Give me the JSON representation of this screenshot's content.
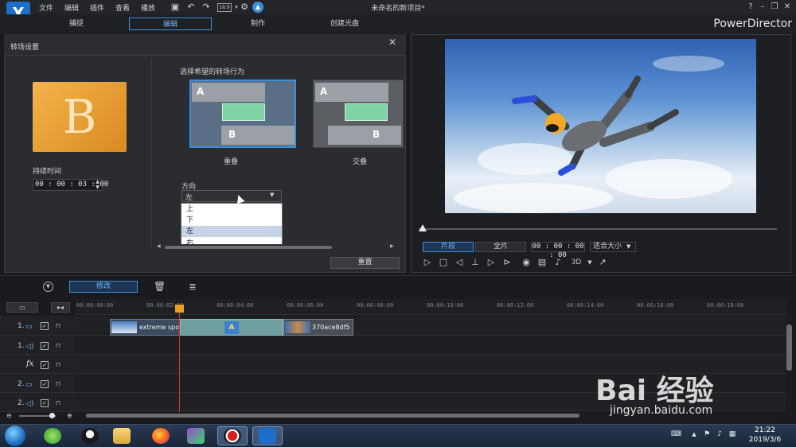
{
  "app": {
    "logo_letter": "X",
    "menu": [
      "文件",
      "编辑",
      "插件",
      "查看",
      "播放"
    ],
    "document_title": "未命名的新项目*",
    "brand": "PowerDirector",
    "window_buttons": [
      "?",
      "–",
      "❐",
      "✕"
    ],
    "toolbar_icons": [
      "save-icon",
      "undo-icon",
      "redo-icon",
      "aspect-ratio-icon",
      "settings-icon",
      "upgrade-icon"
    ],
    "aspect_label": "16:9"
  },
  "modes": [
    "捕捉",
    "编辑",
    "制作",
    "创建光盘"
  ],
  "active_mode": "编辑",
  "transition_panel": {
    "title": "转场设置",
    "preview_letter": "B",
    "duration_label": "持续时间",
    "duration_value": "00 : 00 : 03 : 00",
    "behavior_label": "选择希望的转场行为",
    "options": [
      {
        "label": "重叠",
        "a": "A",
        "b": "B"
      },
      {
        "label": "交叠",
        "a": "A",
        "b": "B"
      }
    ],
    "direction_label": "方向",
    "direction_selected": "左",
    "direction_options": [
      "上",
      "下",
      "左",
      "右"
    ],
    "reset_label": "重置"
  },
  "preview": {
    "clip_label": "片段",
    "movie_label": "全片",
    "timecode": "00 : 00 : 00 : 00",
    "fit_label": "适合大小",
    "three_d_label": "3D"
  },
  "timeline": {
    "modify_label": "修改",
    "ruler": [
      "00:00:00:00",
      "00:00:02:00",
      "00:00:04:00",
      "00:00:06:00",
      "00:00:08:00",
      "00:00:10:00",
      "00:00:12:00",
      "00:00:14:00",
      "00:00:16:00",
      "00:00:18:00"
    ],
    "tracks": [
      {
        "num": "1.",
        "type": "video"
      },
      {
        "num": "1.",
        "type": "audio"
      },
      {
        "num": "",
        "type": "fx",
        "label": "fx"
      },
      {
        "num": "2.",
        "type": "video"
      },
      {
        "num": "2.",
        "type": "audio"
      }
    ],
    "clip1_name": "extreme spo",
    "clip2_name": "370ace8df5",
    "transition_letter": "A"
  },
  "taskbar": {
    "time": "21:22",
    "date": "2019/3/6"
  },
  "watermark": {
    "main": "Bai 经验",
    "sub": "jingyan.baidu.com"
  }
}
